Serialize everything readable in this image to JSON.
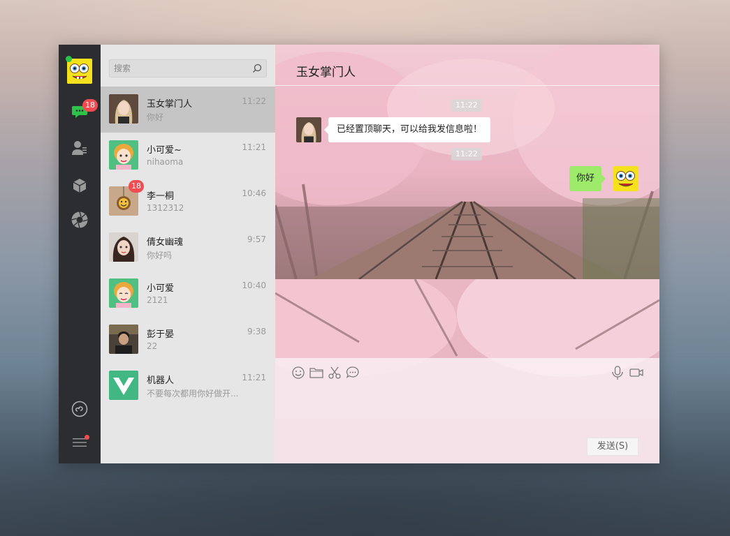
{
  "search": {
    "placeholder": "搜索"
  },
  "sidebar": {
    "unread_badge": "18",
    "icons": [
      "chat-icon",
      "contacts-icon",
      "collection-icon",
      "moments-icon",
      "miniprogram-icon",
      "menu-icon"
    ]
  },
  "chats": [
    {
      "name": "玉女掌门人",
      "preview": "你好",
      "time": "11:22",
      "active": true
    },
    {
      "name": "小可爱~",
      "preview": "nihaoma",
      "time": "11:21"
    },
    {
      "name": "李一桐",
      "preview": "1312312",
      "time": "10:46",
      "badge": "18"
    },
    {
      "name": "倩女幽魂",
      "preview": "你好吗",
      "time": "9:57"
    },
    {
      "name": "小可爱",
      "preview": "2121",
      "time": "10:40"
    },
    {
      "name": "彭于晏",
      "preview": "22",
      "time": "9:38"
    },
    {
      "name": "机器人",
      "preview": "不要每次都用你好做开...",
      "time": "11:21"
    }
  ],
  "conversation": {
    "title": "玉女掌门人",
    "time1": "11:22",
    "incoming": "已经置顶聊天，可以给我发信息啦！",
    "time2": "11:22",
    "outgoing": "你好"
  },
  "composer": {
    "send_label": "发送(S)"
  },
  "colors": {
    "accent_green": "#9eea6a",
    "badge_red": "#f04c52",
    "sidebar_bg": "#2b2d31"
  }
}
